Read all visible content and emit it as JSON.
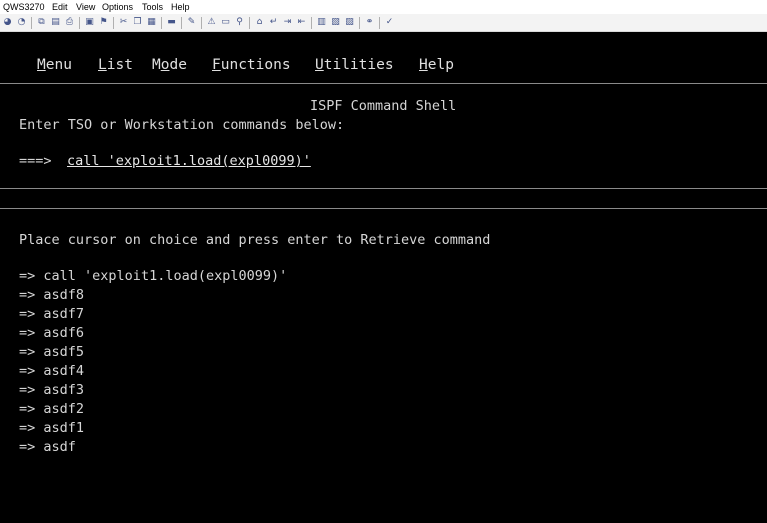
{
  "window": {
    "menu": [
      "QWS3270",
      "Edit",
      "View",
      "Options",
      "Tools",
      "Help"
    ]
  },
  "toolbar_icons": [
    "connect-icon",
    "disconnect-icon",
    "copy-screen-icon",
    "screen-icon",
    "print-icon",
    "capture-icon",
    "macro-icon",
    "cut-icon",
    "copy-icon",
    "paste-icon",
    "keyboard-icon",
    "settings-icon",
    "alert-icon",
    "monitor-icon",
    "link-icon",
    "home-icon",
    "enter-icon",
    "field-icon",
    "tab-icon",
    "key1-icon",
    "key2-icon",
    "key3-icon",
    "attach-icon",
    "spell-icon"
  ],
  "ispf": {
    "menu": [
      {
        "hotkey": "M",
        "rest": "enu"
      },
      {
        "hotkey": "L",
        "rest": "ist"
      },
      {
        "pre": "M",
        "hotkey": "o",
        "rest": "de"
      },
      {
        "hotkey": "F",
        "rest": "unctions"
      },
      {
        "hotkey": "U",
        "rest": "tilities"
      },
      {
        "hotkey": "H",
        "rest": "elp"
      }
    ],
    "title": "ISPF Command Shell",
    "instructions": "Enter TSO or Workstation commands below:",
    "prompt": "===>",
    "command_value": "call 'exploit1.load(expl0099)'",
    "retrieve_hint": "Place cursor on choice and press enter to Retrieve command",
    "history_prefix": "=>",
    "history": [
      "call 'exploit1.load(expl0099)'",
      "asdf8",
      "asdf7",
      "asdf6",
      "asdf5",
      "asdf4",
      "asdf3",
      "asdf2",
      "asdf1",
      "asdf"
    ]
  }
}
